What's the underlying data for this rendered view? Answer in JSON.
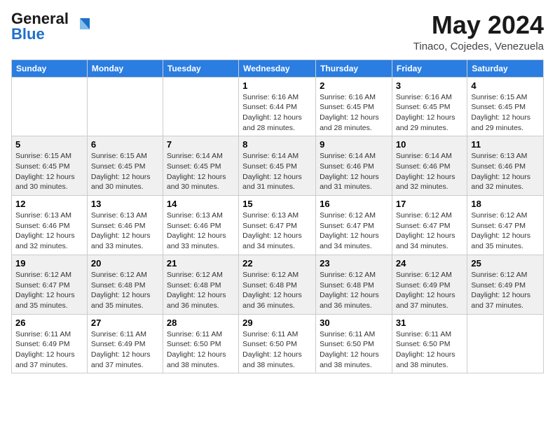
{
  "header": {
    "logo_general": "General",
    "logo_blue": "Blue",
    "month_year": "May 2024",
    "location": "Tinaco, Cojedes, Venezuela"
  },
  "days_of_week": [
    "Sunday",
    "Monday",
    "Tuesday",
    "Wednesday",
    "Thursday",
    "Friday",
    "Saturday"
  ],
  "weeks": [
    [
      {
        "day": "",
        "info": ""
      },
      {
        "day": "",
        "info": ""
      },
      {
        "day": "",
        "info": ""
      },
      {
        "day": "1",
        "info": "Sunrise: 6:16 AM\nSunset: 6:44 PM\nDaylight: 12 hours and 28 minutes."
      },
      {
        "day": "2",
        "info": "Sunrise: 6:16 AM\nSunset: 6:45 PM\nDaylight: 12 hours and 28 minutes."
      },
      {
        "day": "3",
        "info": "Sunrise: 6:16 AM\nSunset: 6:45 PM\nDaylight: 12 hours and 29 minutes."
      },
      {
        "day": "4",
        "info": "Sunrise: 6:15 AM\nSunset: 6:45 PM\nDaylight: 12 hours and 29 minutes."
      }
    ],
    [
      {
        "day": "5",
        "info": "Sunrise: 6:15 AM\nSunset: 6:45 PM\nDaylight: 12 hours and 30 minutes."
      },
      {
        "day": "6",
        "info": "Sunrise: 6:15 AM\nSunset: 6:45 PM\nDaylight: 12 hours and 30 minutes."
      },
      {
        "day": "7",
        "info": "Sunrise: 6:14 AM\nSunset: 6:45 PM\nDaylight: 12 hours and 30 minutes."
      },
      {
        "day": "8",
        "info": "Sunrise: 6:14 AM\nSunset: 6:45 PM\nDaylight: 12 hours and 31 minutes."
      },
      {
        "day": "9",
        "info": "Sunrise: 6:14 AM\nSunset: 6:46 PM\nDaylight: 12 hours and 31 minutes."
      },
      {
        "day": "10",
        "info": "Sunrise: 6:14 AM\nSunset: 6:46 PM\nDaylight: 12 hours and 32 minutes."
      },
      {
        "day": "11",
        "info": "Sunrise: 6:13 AM\nSunset: 6:46 PM\nDaylight: 12 hours and 32 minutes."
      }
    ],
    [
      {
        "day": "12",
        "info": "Sunrise: 6:13 AM\nSunset: 6:46 PM\nDaylight: 12 hours and 32 minutes."
      },
      {
        "day": "13",
        "info": "Sunrise: 6:13 AM\nSunset: 6:46 PM\nDaylight: 12 hours and 33 minutes."
      },
      {
        "day": "14",
        "info": "Sunrise: 6:13 AM\nSunset: 6:46 PM\nDaylight: 12 hours and 33 minutes."
      },
      {
        "day": "15",
        "info": "Sunrise: 6:13 AM\nSunset: 6:47 PM\nDaylight: 12 hours and 34 minutes."
      },
      {
        "day": "16",
        "info": "Sunrise: 6:12 AM\nSunset: 6:47 PM\nDaylight: 12 hours and 34 minutes."
      },
      {
        "day": "17",
        "info": "Sunrise: 6:12 AM\nSunset: 6:47 PM\nDaylight: 12 hours and 34 minutes."
      },
      {
        "day": "18",
        "info": "Sunrise: 6:12 AM\nSunset: 6:47 PM\nDaylight: 12 hours and 35 minutes."
      }
    ],
    [
      {
        "day": "19",
        "info": "Sunrise: 6:12 AM\nSunset: 6:47 PM\nDaylight: 12 hours and 35 minutes."
      },
      {
        "day": "20",
        "info": "Sunrise: 6:12 AM\nSunset: 6:48 PM\nDaylight: 12 hours and 35 minutes."
      },
      {
        "day": "21",
        "info": "Sunrise: 6:12 AM\nSunset: 6:48 PM\nDaylight: 12 hours and 36 minutes."
      },
      {
        "day": "22",
        "info": "Sunrise: 6:12 AM\nSunset: 6:48 PM\nDaylight: 12 hours and 36 minutes."
      },
      {
        "day": "23",
        "info": "Sunrise: 6:12 AM\nSunset: 6:48 PM\nDaylight: 12 hours and 36 minutes."
      },
      {
        "day": "24",
        "info": "Sunrise: 6:12 AM\nSunset: 6:49 PM\nDaylight: 12 hours and 37 minutes."
      },
      {
        "day": "25",
        "info": "Sunrise: 6:12 AM\nSunset: 6:49 PM\nDaylight: 12 hours and 37 minutes."
      }
    ],
    [
      {
        "day": "26",
        "info": "Sunrise: 6:11 AM\nSunset: 6:49 PM\nDaylight: 12 hours and 37 minutes."
      },
      {
        "day": "27",
        "info": "Sunrise: 6:11 AM\nSunset: 6:49 PM\nDaylight: 12 hours and 37 minutes."
      },
      {
        "day": "28",
        "info": "Sunrise: 6:11 AM\nSunset: 6:50 PM\nDaylight: 12 hours and 38 minutes."
      },
      {
        "day": "29",
        "info": "Sunrise: 6:11 AM\nSunset: 6:50 PM\nDaylight: 12 hours and 38 minutes."
      },
      {
        "day": "30",
        "info": "Sunrise: 6:11 AM\nSunset: 6:50 PM\nDaylight: 12 hours and 38 minutes."
      },
      {
        "day": "31",
        "info": "Sunrise: 6:11 AM\nSunset: 6:50 PM\nDaylight: 12 hours and 38 minutes."
      },
      {
        "day": "",
        "info": ""
      }
    ]
  ]
}
